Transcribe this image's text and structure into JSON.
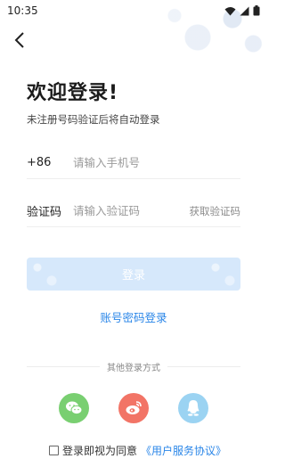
{
  "status_bar": {
    "time": "10:35"
  },
  "header": {
    "title": "欢迎登录!",
    "subtitle": "未注册号码验证后将自动登录"
  },
  "phone_row": {
    "prefix": "+86",
    "placeholder": "请输入手机号",
    "value": ""
  },
  "code_row": {
    "label": "验证码",
    "placeholder": "请输入验证码",
    "value": "",
    "get_code": "获取验证码"
  },
  "login_button": {
    "label": "登录"
  },
  "password_login": {
    "label": "账号密码登录"
  },
  "other_methods": {
    "title": "其他登录方式",
    "items": [
      "wechat-icon",
      "weibo-icon",
      "qq-icon"
    ]
  },
  "agreement": {
    "text": "登录即视为同意",
    "link": "《用户服务协议》",
    "checked": false
  },
  "colors": {
    "accent": "#2a86e8",
    "button_disabled": "#d6e8fb",
    "wechat": "#79cf71",
    "weibo": "#f27466",
    "qq": "#9bd3f2"
  }
}
